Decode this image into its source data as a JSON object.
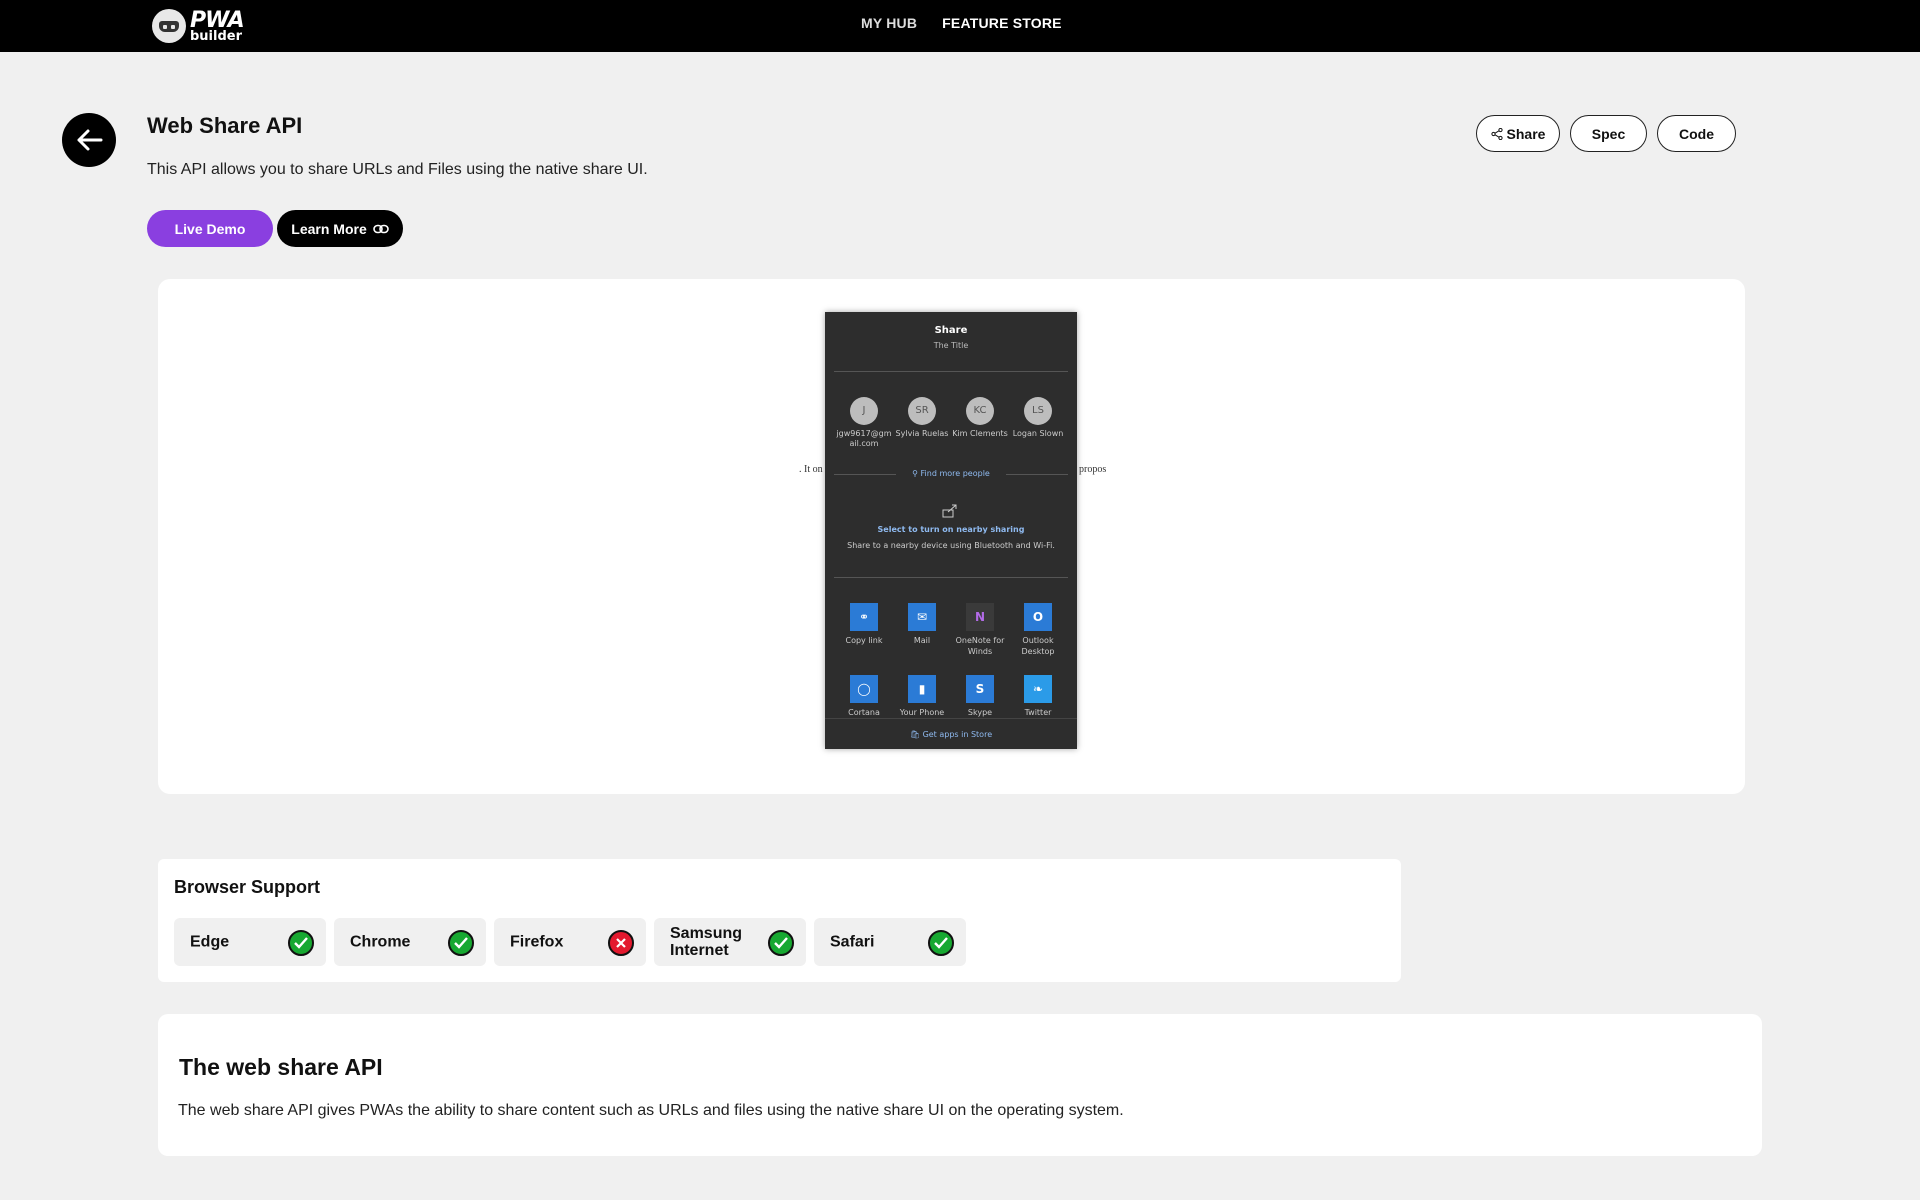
{
  "nav": {
    "logo_line1": "PWA",
    "logo_line2": "builder",
    "links": [
      "MY HUB",
      "FEATURE STORE"
    ]
  },
  "feature": {
    "title": "Web Share API",
    "description": "This API allows you to share URLs and Files using the native share UI.",
    "live_demo_label": "Live Demo",
    "learn_more_label": "Learn More",
    "share_label": "Share",
    "spec_label": "Spec",
    "code_label": "Code"
  },
  "demo": {
    "underlying_left": ". It on",
    "underlying_right": "propos",
    "panel": {
      "title": "Share",
      "subtitle": "The Title",
      "contacts": [
        {
          "initials": "J",
          "name": "jgw9617@gmail.com"
        },
        {
          "initials": "SR",
          "name": "Sylvia Ruelas"
        },
        {
          "initials": "KC",
          "name": "Kim Clements"
        },
        {
          "initials": "LS",
          "name": "Logan Slown"
        }
      ],
      "find_more": "Find more people",
      "nearby_title": "Select to turn on nearby sharing",
      "nearby_sub": "Share to a nearby device using Bluetooth and Wi-Fi.",
      "apps_row1": [
        {
          "name": "Copy link",
          "icon": "link-icon",
          "color": "#2b7bd6"
        },
        {
          "name": "Mail",
          "icon": "mail-icon",
          "color": "#2b7bd6"
        },
        {
          "name": "OneNote for Winds",
          "icon": "onenote-icon",
          "color": "#3a3a3a"
        },
        {
          "name": "Outlook Desktop",
          "icon": "outlook-icon",
          "color": "#2b7bd6"
        }
      ],
      "apps_row2": [
        {
          "name": "Cortana",
          "icon": "cortana-icon",
          "color": "#2b7bd6"
        },
        {
          "name": "Your Phone",
          "icon": "phone-icon",
          "color": "#2b7bd6"
        },
        {
          "name": "Skype",
          "icon": "skype-icon",
          "color": "#2b7bd6"
        },
        {
          "name": "Twitter",
          "icon": "twitter-icon",
          "color": "#2b7bd6"
        }
      ],
      "store_label": "Get apps in Store"
    }
  },
  "support": {
    "title": "Browser Support",
    "browsers": [
      {
        "name": "Edge",
        "supported": true
      },
      {
        "name": "Chrome",
        "supported": true
      },
      {
        "name": "Firefox",
        "supported": false
      },
      {
        "name": "Samsung Internet",
        "supported": true
      },
      {
        "name": "Safari",
        "supported": true
      }
    ],
    "colors": {
      "supported": "#17a831",
      "unsupported": "#e3192e"
    }
  },
  "info": {
    "title": "The web share API",
    "text": "The web share API gives PWAs the ability to share content such as URLs and files using the native share UI on the operating system."
  },
  "colors": {
    "accent": "#8a3fe0",
    "nav_bg": "#000000",
    "page_bg": "#f0f0f0"
  }
}
